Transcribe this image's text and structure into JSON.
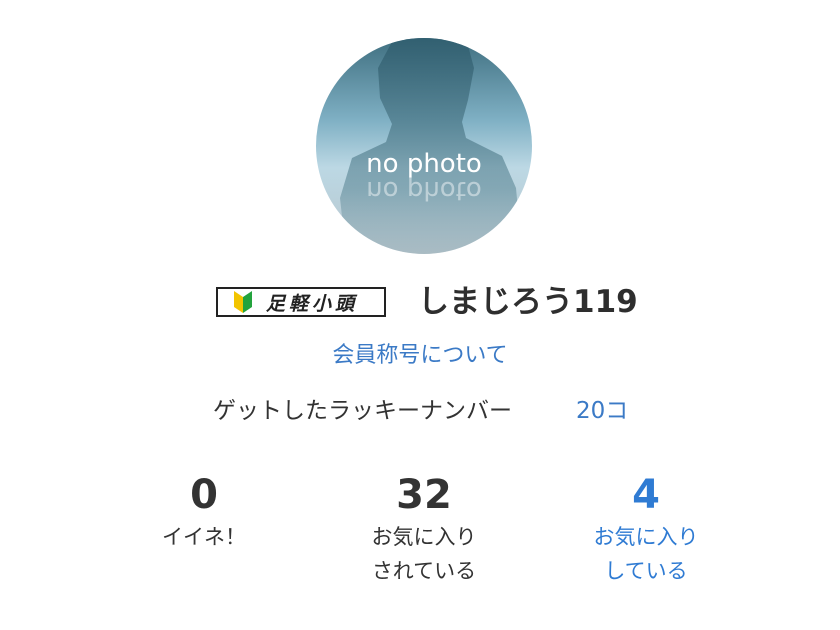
{
  "profile": {
    "avatar_text": "no photo",
    "rank_badge": "足軽小頭",
    "username": "しまじろう119",
    "title_link": "会員称号について"
  },
  "lucky": {
    "label": "ゲットしたラッキーナンバー",
    "count": "20コ"
  },
  "stats": [
    {
      "value": "0",
      "label_line1": "イイネ！",
      "label_line2": ""
    },
    {
      "value": "32",
      "label_line1": "お気に入り",
      "label_line2": "されている"
    },
    {
      "value": "4",
      "label_line1": "お気に入り",
      "label_line2": "している"
    }
  ],
  "colors": {
    "link": "#3b7ac6",
    "stat_link": "#2f7bd3",
    "text": "#333333"
  },
  "icons": {
    "rank_mark": "beginner-mark-icon",
    "avatar": "silhouette-placeholder"
  }
}
